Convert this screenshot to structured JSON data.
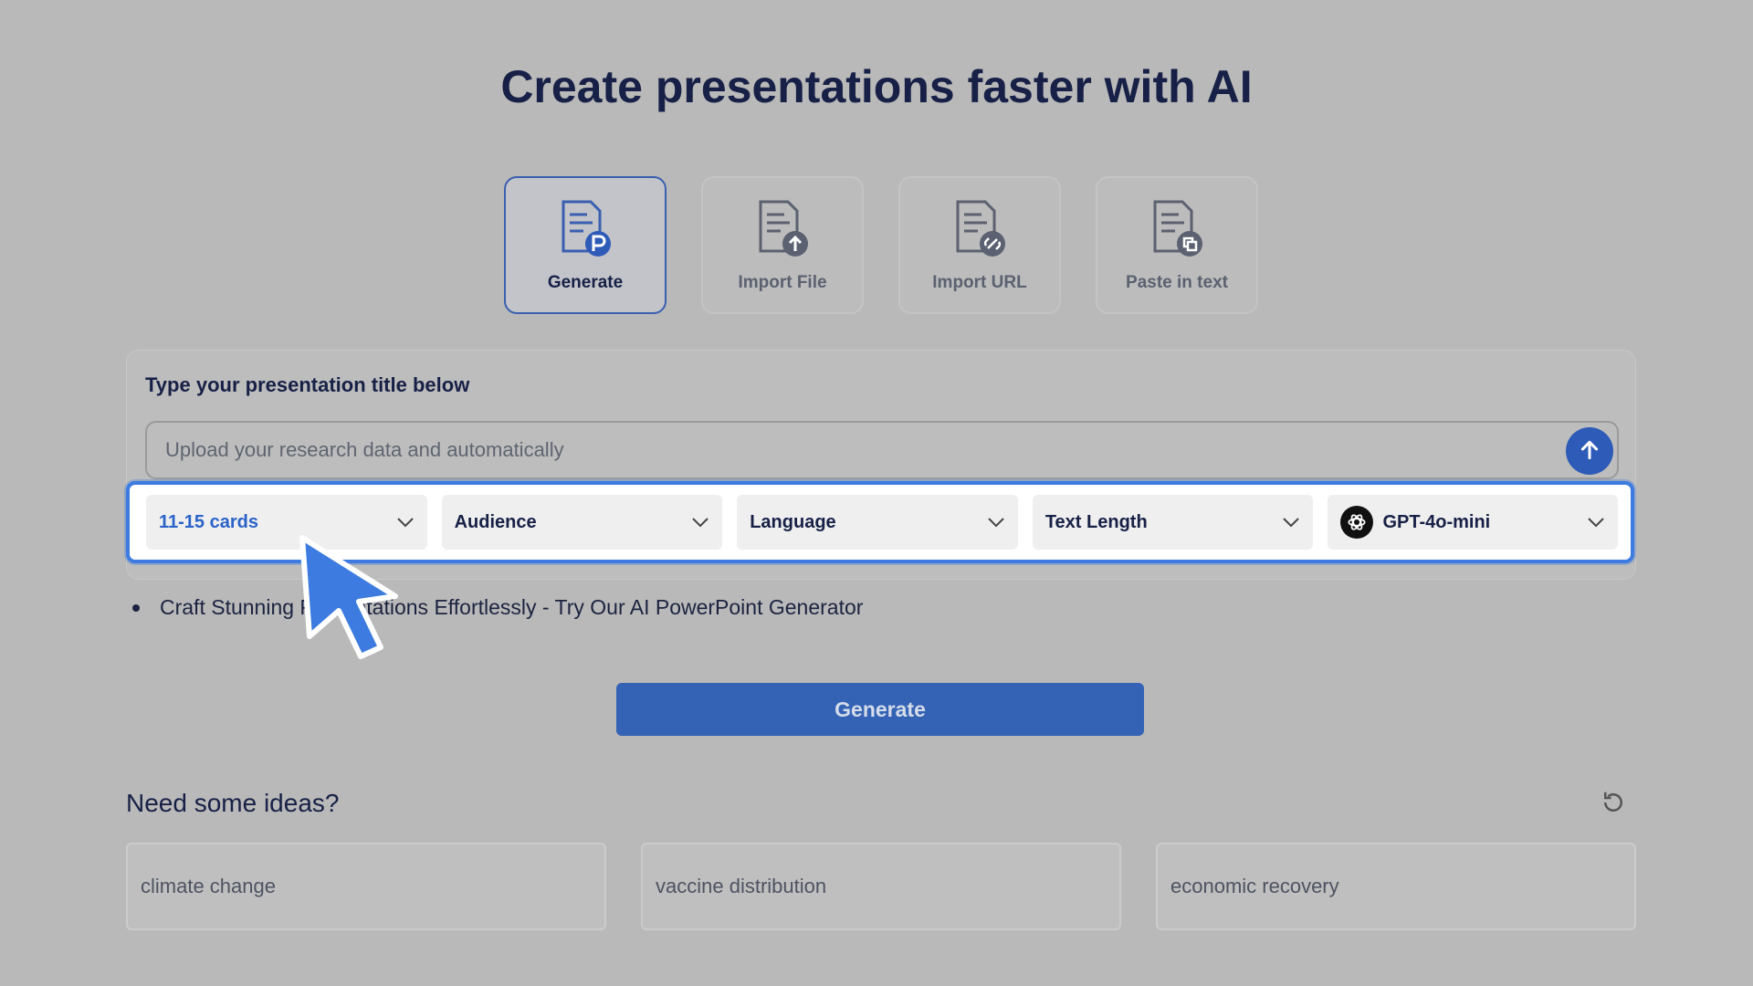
{
  "heading": "Create presentations faster with AI",
  "modes": [
    {
      "label": "Generate",
      "icon": "doc-generate-icon",
      "active": true
    },
    {
      "label": "Import File",
      "icon": "doc-upload-icon",
      "active": false
    },
    {
      "label": "Import URL",
      "icon": "doc-link-icon",
      "active": false
    },
    {
      "label": "Paste in text",
      "icon": "doc-paste-icon",
      "active": false
    }
  ],
  "panel": {
    "label": "Type your presentation title below",
    "input_placeholder": "Upload your research data and automatically",
    "input_value": ""
  },
  "options": {
    "cards": "11-15 cards",
    "audience": "Audience",
    "language": "Language",
    "text_length": "Text Length",
    "model": "GPT-4o-mini"
  },
  "hint": "Craft Stunning Presentations Effortlessly - Try Our AI PowerPoint Generator",
  "generate_label": "Generate",
  "ideas": {
    "title": "Need some ideas?",
    "items": [
      "climate change",
      "vaccine distribution",
      "economic recovery"
    ]
  },
  "colors": {
    "accent": "#3463b5",
    "highlight_border": "#3d7be0",
    "heading": "#172046",
    "background": "#b9b9b9"
  }
}
